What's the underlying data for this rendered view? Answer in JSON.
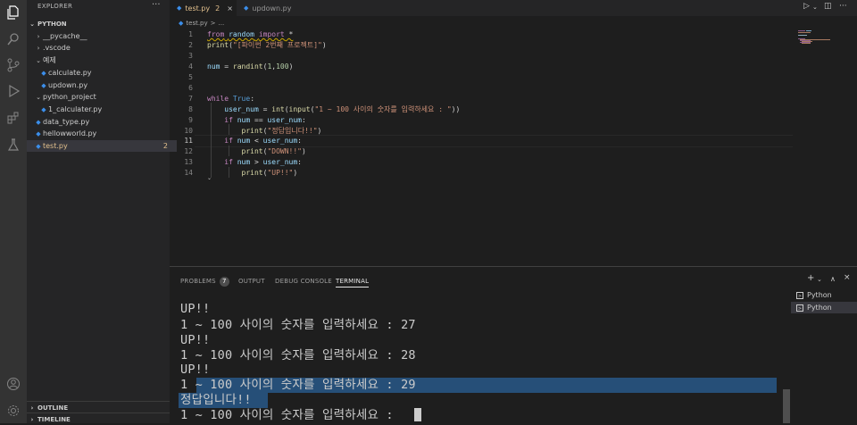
{
  "sidebar": {
    "title": "EXPLORER",
    "more": "···",
    "root": "PYTHON",
    "items": [
      {
        "label": "__pycache__",
        "kind": "folder-closed"
      },
      {
        "label": ".vscode",
        "kind": "folder-closed"
      },
      {
        "label": "예제",
        "kind": "folder-open"
      },
      {
        "label": "calculate.py",
        "kind": "py"
      },
      {
        "label": "updown.py",
        "kind": "py"
      },
      {
        "label": "python_project",
        "kind": "folder-open"
      },
      {
        "label": "1_calculater.py",
        "kind": "py"
      },
      {
        "label": "data_type.py",
        "kind": "py"
      },
      {
        "label": "hellowworld.py",
        "kind": "py"
      },
      {
        "label": "test.py",
        "kind": "py",
        "badge": "2"
      }
    ],
    "outline": "OUTLINE",
    "timeline": "TIMELINE"
  },
  "tabs": [
    {
      "label": "test.py",
      "problems": "2",
      "close": "×",
      "active": true
    },
    {
      "label": "updown.py",
      "active": false
    }
  ],
  "breadcrumb": {
    "file": "test.py",
    "sep": ">",
    "more": "..."
  },
  "editor": {
    "line_numbers": [
      "1",
      "2",
      "3",
      "4",
      "5",
      "6",
      "7",
      "8",
      "9",
      "10",
      "11",
      "12",
      "13",
      "14"
    ],
    "current_line": "11",
    "lines": [
      "from random import *",
      "print(\"[파이썬 2번째 프로젝트]\")",
      "",
      "num = randint(1,100)",
      "",
      "",
      "while True:",
      "    user_num = int(input(\"1 ~ 100 사이의 숫자를 입력하세요 : \"))",
      "    if num == user_num:",
      "        print(\"정답입니다!!\")",
      "    if num < user_num:",
      "        print(\"DOWN!!\")",
      "    if num > user_num:",
      "        print(\"UP!!\")"
    ]
  },
  "panel": {
    "tabs": [
      "PROBLEMS",
      "OUTPUT",
      "DEBUG CONSOLE",
      "TERMINAL"
    ],
    "problems_count": "7",
    "active_tab": "TERMINAL",
    "terminal_lines": [
      "UP!!",
      "1 ~ 100 사이의 숫자를 입력하세요 : 27",
      "UP!!",
      "1 ~ 100 사이의 숫자를 입력하세요 : 28",
      "UP!!",
      "1 ~ 100 사이의 숫자를 입력하세요 : 29",
      "정답입니다!!",
      "1 ~ 100 사이의 숫자를 입력하세요 : "
    ],
    "terminals": [
      "Python",
      "Python"
    ],
    "selected_terminal": 1
  },
  "colors": {
    "accent": "#007acc",
    "selection": "#264f78",
    "modified": "#e2c08d"
  }
}
